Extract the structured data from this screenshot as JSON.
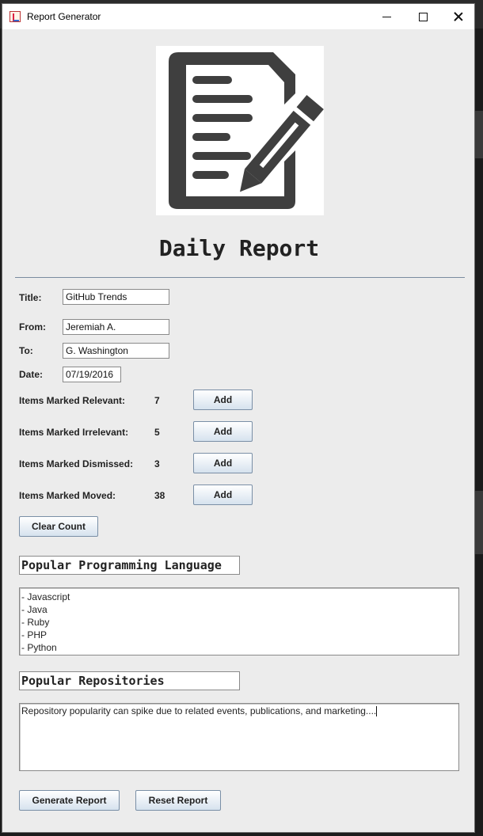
{
  "window": {
    "title": "Report Generator"
  },
  "header": {
    "heading": "Daily Report"
  },
  "form": {
    "title_label": "Title:",
    "title_value": "GitHub Trends",
    "from_label": "From:",
    "from_value": "Jeremiah A.",
    "to_label": "To:",
    "to_value": "G. Washington",
    "date_label": "Date:",
    "date_value": "07/19/2016"
  },
  "counters": [
    {
      "label": "Items Marked Relevant:",
      "count": "7",
      "button": "Add"
    },
    {
      "label": "Items Marked Irrelevant:",
      "count": "5",
      "button": "Add"
    },
    {
      "label": "Items Marked Dismissed:",
      "count": "3",
      "button": "Add"
    },
    {
      "label": "Items Marked Moved:",
      "count": "38",
      "button": "Add"
    }
  ],
  "clear_button": "Clear Count",
  "languages": {
    "heading": "Popular Programming Language",
    "items": [
      "- Javascript",
      "- Java",
      "- Ruby",
      "- PHP",
      "- Python"
    ]
  },
  "repositories": {
    "heading": "Popular Repositories",
    "text": "Repository popularity can spike due to related events, publications, and marketing...."
  },
  "footer": {
    "generate_button": "Generate Report",
    "reset_button": "Reset Report"
  },
  "colors": {
    "window_bg": "#ececec",
    "icon_dark": "#3f3f3f",
    "button_top": "#ffffff",
    "button_bottom": "#d6e2ee"
  },
  "icons": {
    "logo": "document-pencil-icon"
  }
}
